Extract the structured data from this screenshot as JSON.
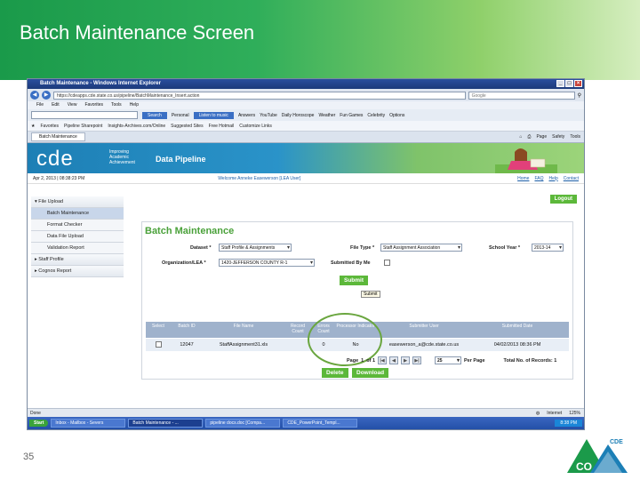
{
  "slide": {
    "title": "Batch Maintenance Screen",
    "page_number": "35",
    "logo_text": "CDE",
    "logo_state": "CO"
  },
  "browser": {
    "window_title": "Batch Maintenance - Windows Internet Explorer",
    "address": "https://cdeapps.cde.state.co.us/pipeline/BatchMaintenance_Insert.action",
    "search_placeholder": "Google",
    "menu": [
      "File",
      "Edit",
      "View",
      "Favorites",
      "Tools",
      "Help"
    ],
    "toolbar": {
      "search_button": "Search",
      "items": [
        "Personal",
        "Listen to music",
        "Answers",
        "YouTube",
        "Daily Horoscope",
        "Weather",
        "Fun Games",
        "Celebrity",
        "Options"
      ]
    },
    "favorites": {
      "label": "Favorites",
      "items": [
        "Pipeline Sharepoint",
        "Insights-Archives.com/Online",
        "Suggested Sites",
        "Free Hotmail",
        "Customize Links"
      ]
    },
    "tab_label": "Batch Maintenance",
    "tab_tools": [
      "Page",
      "Safety",
      "Tools"
    ],
    "status_left": "Done",
    "status_zone": "Internet",
    "status_zoom": "125%"
  },
  "taskbar": {
    "start": "Start",
    "tasks": [
      "Inbox - Mailbox - Severs",
      "Batch Maintenance - ...",
      "pipeline docs.doc [Compa...",
      "CDE_PowerPoint_Templ..."
    ],
    "clock": "8:38 PM"
  },
  "app": {
    "logo": "cde",
    "logo_subtitle": "Improving Academic Achievement",
    "product": "Data Pipeline",
    "datetime": "Apr 2, 2013 | 08:38:23 PM",
    "welcome": "Welcome Anneke Easewerson [LEA User]",
    "top_links": [
      "Home",
      "FAQ",
      "Help",
      "Contact"
    ],
    "logout": "Logout",
    "nav": [
      {
        "label": "File Upload",
        "level": 0
      },
      {
        "label": "Batch Maintenance",
        "level": 1,
        "active": true
      },
      {
        "label": "Format Checker",
        "level": 1
      },
      {
        "label": "Data File Upload",
        "level": 1
      },
      {
        "label": "Validation Report",
        "level": 1
      },
      {
        "label": "Staff Profile",
        "level": 0
      },
      {
        "label": "Cognos Report",
        "level": 0
      }
    ],
    "panel_title": "Batch Maintenance",
    "form": {
      "dataset_label": "Dataset *",
      "dataset_value": "Staff Profile & Assignments",
      "filetype_label": "File Type *",
      "filetype_value": "Staff Assignment Association",
      "schoolyear_label": "School Year *",
      "schoolyear_value": "2013-14",
      "org_label": "Organization/LEA *",
      "org_value": "1420-JEFFERSON COUNTY R-1",
      "submitted_by_me_label": "Submitted By Me",
      "submit_label": "Submit",
      "submit_tooltip": "Submit"
    },
    "grid": {
      "headers": [
        "Select",
        "Batch ID",
        "File Name",
        "Record Count",
        "Errors Count",
        "Processor Indicator",
        "Submitter User",
        "Submitted Date"
      ],
      "rows": [
        [
          "",
          "12047",
          "StaffAssignment31.xls",
          "",
          "0",
          "No",
          "easewerson_a@cde.state.co.us",
          "04/02/2013 08:36 PM"
        ]
      ]
    },
    "pager": {
      "page_label": "Page",
      "page_value": "1",
      "of_label": "of 1",
      "per_page_value": "25",
      "per_page_label": "Per Page",
      "total_label": "Total No. of Records: 1"
    },
    "delete_label": "Delete",
    "download_label": "Download"
  }
}
